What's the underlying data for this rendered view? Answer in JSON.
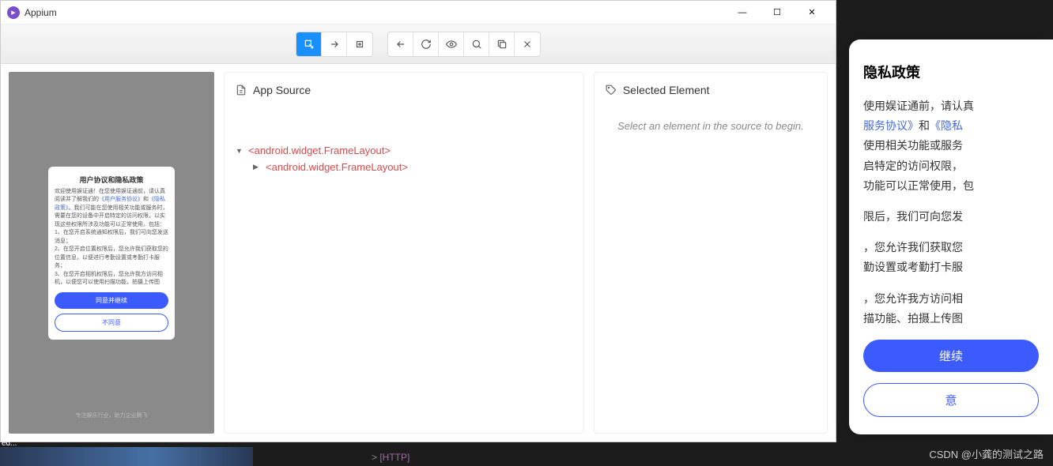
{
  "window": {
    "title": "Appium",
    "controls": {
      "min": "—",
      "max": "☐",
      "close": "✕"
    }
  },
  "toolbar": {
    "group1": [
      "select",
      "swipe",
      "tap"
    ],
    "group2": [
      "back",
      "refresh",
      "eye",
      "search",
      "copy",
      "close"
    ]
  },
  "device": {
    "dialog_title": "用户协议和隐私政策",
    "dialog_intro_pre": "欢迎使用娱证通！在您使用娱证通前，请认真阅读并了解我们的",
    "dialog_link1": "《用户服务协议》",
    "dialog_and": "和",
    "dialog_link2": "《隐私政策》",
    "dialog_intro_post": "。我们可能在您使用相关功能或服务时，需要在您的设备中开启特定的访问权限，以实现这些权限所涉及功能可以正常使用，包括：",
    "dialog_item1": "1、在您开启系统通知权限后，我们可向您发送消息；",
    "dialog_item2": "2、在您开启位置权限后，您允许我们获取您的位置信息，以便进行考勤设置或考勤打卡服务；",
    "dialog_item3": "3、在您开启相机权限后，您允许我方访问相机，以便您可以使用扫描功能，拍摄上传图",
    "btn_agree": "同意并继续",
    "btn_disagree": "不同意",
    "footer": "专注娱乐行业，助力企业腾飞"
  },
  "source": {
    "title": "App Source",
    "tree": {
      "node1": "<android.widget.FrameLayout>",
      "node2": "<android.widget.FrameLayout>"
    }
  },
  "selected": {
    "title": "Selected Element",
    "placeholder": "Select an element in the source to begin."
  },
  "overlay": {
    "title": "隐私政策",
    "line1_pre": "使用娱证通前，请认真",
    "line2_link1": "服务协议》",
    "line2_and": "和",
    "line2_link2": "《隐私",
    "line3": "使用相关功能或服务",
    "line4": "启特定的访问权限，",
    "line5": "功能可以正常使用，包",
    "para2": "限后，我们可向您发",
    "para3a": "，您允许我们获取您",
    "para3b": "勤设置或考勤打卡服",
    "para4a": "，您允许我方访问相",
    "para4b": "描功能、拍摄上传图",
    "btn1": "继续",
    "btn2": "意"
  },
  "watermark": "CSDN @小龚的测试之路",
  "terminal": {
    "http": "[HTTP]"
  },
  "ed": "ed..."
}
